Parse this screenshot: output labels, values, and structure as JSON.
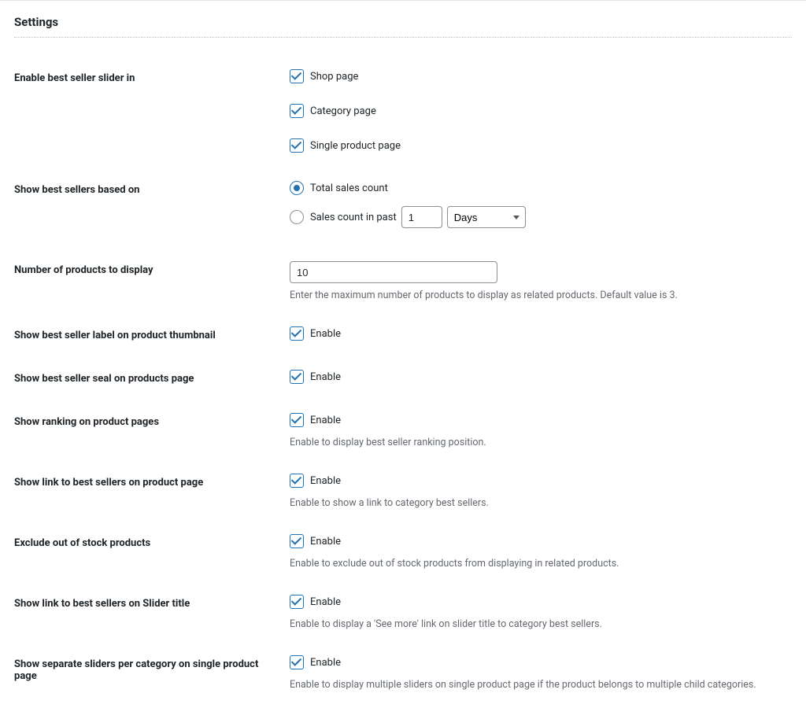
{
  "section_title": "Settings",
  "rows": {
    "enable_slider_in": {
      "label": "Enable best seller slider in",
      "shop": "Shop page",
      "category": "Category page",
      "single": "Single product page"
    },
    "based_on": {
      "label": "Show best sellers based on",
      "total": "Total sales count",
      "past_prefix": "Sales count in past",
      "past_number": "1",
      "past_unit": "Days"
    },
    "num_products": {
      "label": "Number of products to display",
      "value": "10",
      "desc": "Enter the maximum number of products to display as related products. Default value is 3."
    },
    "label_thumb": {
      "label": "Show best seller label on product thumbnail",
      "enable": "Enable"
    },
    "seal": {
      "label": "Show best seller seal on products page",
      "enable": "Enable"
    },
    "ranking": {
      "label": "Show ranking on product pages",
      "enable": "Enable",
      "desc": "Enable to display best seller ranking position."
    },
    "link_product": {
      "label": "Show link to best sellers on product page",
      "enable": "Enable",
      "desc": "Enable to show a link to category best sellers."
    },
    "exclude_oos": {
      "label": "Exclude out of stock products",
      "enable": "Enable",
      "desc": "Enable to exclude out of stock products from displaying in related products."
    },
    "link_slider_title": {
      "label": "Show link to best sellers on Slider title",
      "enable": "Enable",
      "desc": "Enable to display a 'See more' link on slider title to category best sellers."
    },
    "separate_sliders": {
      "label": "Show separate sliders per category on single product page",
      "enable": "Enable",
      "desc": "Enable to display multiple sliders on single product page if the product belongs to multiple child categories."
    }
  }
}
